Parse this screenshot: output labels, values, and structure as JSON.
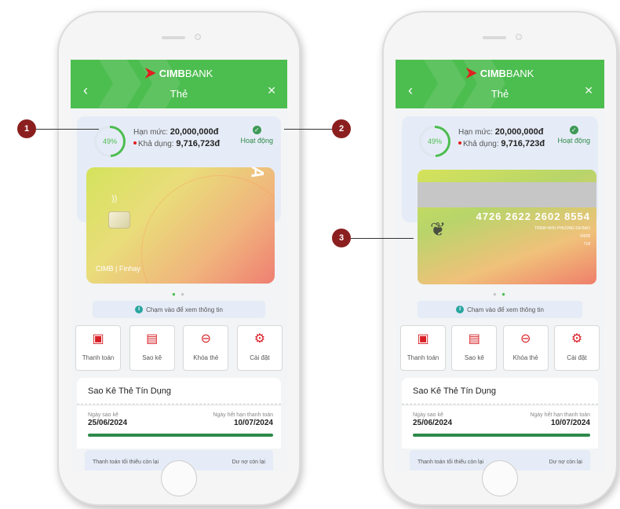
{
  "app": {
    "bank_name_bold": "CIMB",
    "bank_name_rest": "BANK",
    "screen_title": "Thẻ"
  },
  "card_info": {
    "percent": "49%",
    "limit_label": "Hạn mức:",
    "limit_value": "20,000,000đ",
    "available_label": "Khả dụng:",
    "available_value": "9,716,723đ",
    "status": "Hoạt động",
    "network": "VISA",
    "brand_text": "CIMB | Finhay"
  },
  "card_back": {
    "number": "4726 2622 2602 8554",
    "holder": "TRINH NHU PHUONG DA BAO",
    "expiry": "04/28",
    "cvv": "718"
  },
  "hint": "Chạm vào để xem thông tin",
  "actions": [
    {
      "label": "Thanh toán",
      "icon": "wallet-icon"
    },
    {
      "label": "Sao kê",
      "icon": "document-icon"
    },
    {
      "label": "Khóa thẻ",
      "icon": "card-lock-icon"
    },
    {
      "label": "Cài đặt",
      "icon": "gear-icon"
    }
  ],
  "statement": {
    "title": "Sao Kê Thẻ Tín Dụng",
    "date_label": "Ngày sao kê",
    "date_value": "25/06/2024",
    "due_label": "Ngày hết hạn thanh toán",
    "due_value": "10/07/2024",
    "min_label": "Thanh toán tối thiểu còn lại",
    "balance_label": "Dư nợ còn lại"
  },
  "callouts": {
    "one": "1",
    "two": "2",
    "three": "3"
  },
  "colors": {
    "brand_green": "#4cbd4f",
    "accent_red": "#d81f26",
    "callout": "#8b1f1f"
  }
}
